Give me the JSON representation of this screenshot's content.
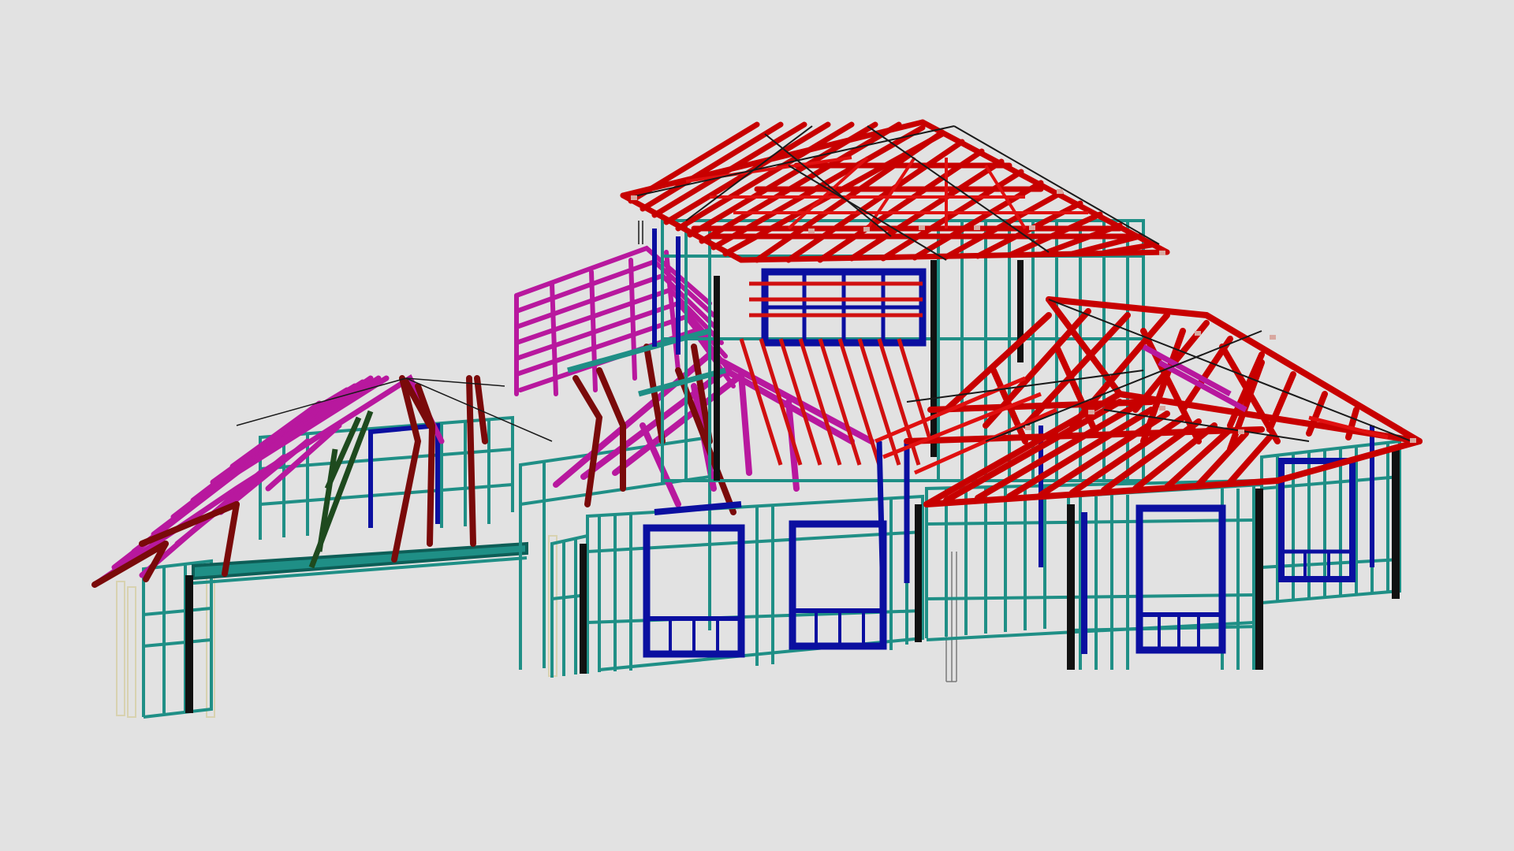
{
  "viewer": {
    "background": "#e2e2e2"
  },
  "model": {
    "colors": {
      "wall_frame": "#1f8f86",
      "wall_frame_dark": "#0d5e57",
      "opening_frame": "#0b0fa0",
      "roof_truss_main": "#c80000",
      "roof_truss_main_light": "#e01010",
      "roof_truss_secondary": "#b8189e",
      "roof_truss_secondary_light": "#d030c0",
      "girder_truss": "#7a0a0a",
      "girder_truss_green": "#1e4a1e",
      "post_black": "#111111",
      "line_black": "#1a1a1a",
      "outline_pale": "#d8d2b0",
      "joint_plate": "#d8a8a0"
    }
  }
}
